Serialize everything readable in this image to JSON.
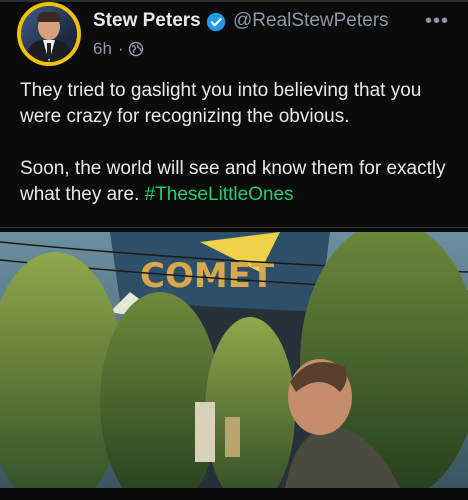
{
  "author": {
    "name": "Stew Peters",
    "handle": "@RealStewPeters",
    "verified": true,
    "avatar_icon": "profile-photo"
  },
  "meta": {
    "time": "6h",
    "separator": "·",
    "audience_icon": "globe-icon"
  },
  "more_label": "•••",
  "tweet": {
    "line1": "They tried to gaslight you into believing that you were crazy for recognizing the obvious.",
    "line2_text": "Soon, the world will see and know them for exactly what they are. ",
    "hashtag": "#TheseLittleOnes"
  },
  "media": {
    "sign_text": "COMET",
    "icon": "video-frame"
  },
  "colors": {
    "background": "#0b0b0c",
    "accent_hashtag": "#1fcf6a",
    "verified_blue": "#1d9bf0",
    "avatar_ring": "#f2c200",
    "muted": "#8b98a5"
  }
}
